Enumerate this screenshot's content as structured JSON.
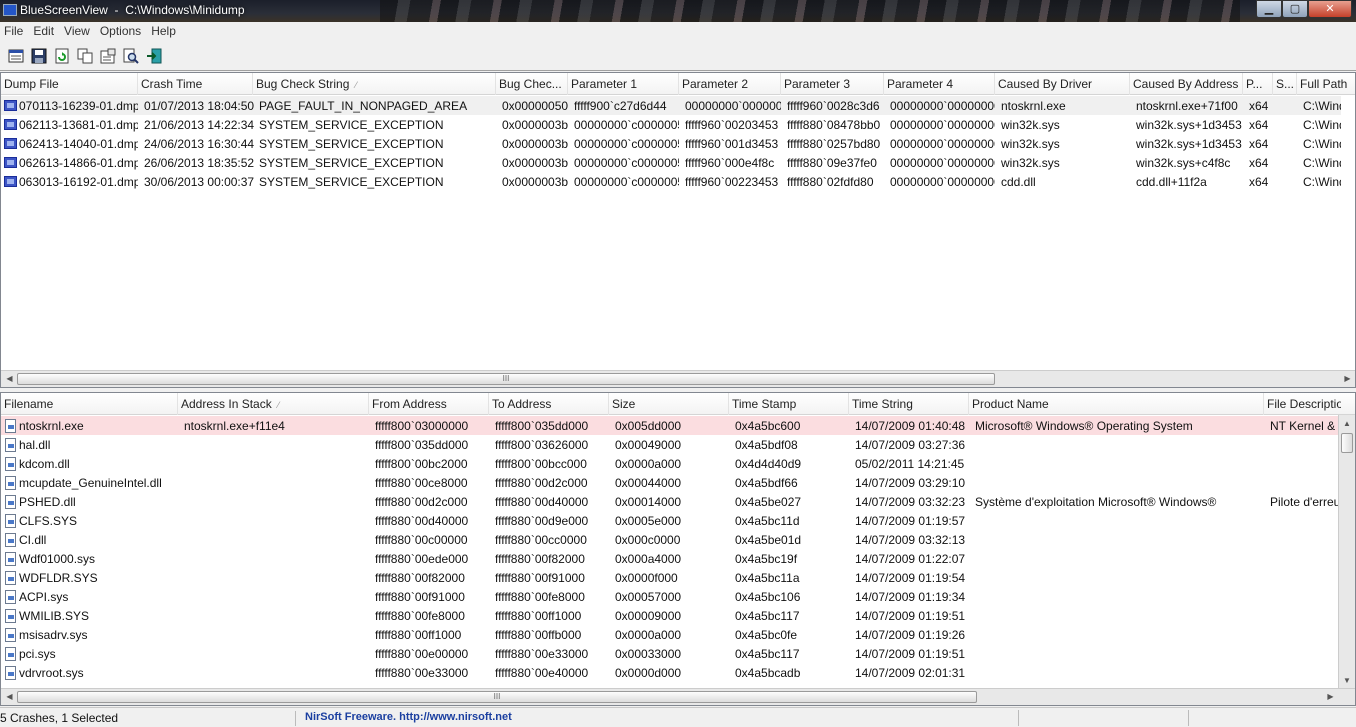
{
  "window": {
    "app_name": "BlueScreenView",
    "path": "C:\\Windows\\Minidump"
  },
  "window_buttons": {
    "minimize": "▁",
    "maximize": "▢",
    "close": "✕"
  },
  "menu": [
    "File",
    "Edit",
    "View",
    "Options",
    "Help"
  ],
  "toolbar": [
    {
      "icon": "html-report-icon"
    },
    {
      "icon": "save-icon"
    },
    {
      "icon": "refresh-icon"
    },
    {
      "icon": "copy-icon"
    },
    {
      "icon": "properties-icon"
    },
    {
      "icon": "find-icon"
    },
    {
      "icon": "exit-icon"
    }
  ],
  "dumps": {
    "columns": [
      "Dump File",
      "Crash Time",
      "Bug Check String",
      "Bug Chec...",
      "Parameter 1",
      "Parameter 2",
      "Parameter 3",
      "Parameter 4",
      "Caused By Driver",
      "Caused By Address",
      "P...",
      "S...",
      "Full Path"
    ],
    "sort_glyph": "⁄",
    "rows": [
      [
        "070113-16239-01.dmp",
        "01/07/2013 18:04:50",
        "PAGE_FAULT_IN_NONPAGED_AREA",
        "0x00000050",
        "fffff900`c27d6d44",
        "00000000`000000...",
        "fffff960`0028c3d6",
        "00000000`00000000",
        "ntoskrnl.exe",
        "ntoskrnl.exe+71f00",
        "x64",
        "",
        "C:\\Windov"
      ],
      [
        "062113-13681-01.dmp",
        "21/06/2013 14:22:34",
        "SYSTEM_SERVICE_EXCEPTION",
        "0x0000003b",
        "00000000`c0000005",
        "fffff960`00203453",
        "fffff880`08478bb0",
        "00000000`00000000",
        "win32k.sys",
        "win32k.sys+1d3453",
        "x64",
        "",
        "C:\\Windov"
      ],
      [
        "062413-14040-01.dmp",
        "24/06/2013 16:30:44",
        "SYSTEM_SERVICE_EXCEPTION",
        "0x0000003b",
        "00000000`c0000005",
        "fffff960`001d3453",
        "fffff880`0257bd80",
        "00000000`00000000",
        "win32k.sys",
        "win32k.sys+1d3453",
        "x64",
        "",
        "C:\\Windov"
      ],
      [
        "062613-14866-01.dmp",
        "26/06/2013 18:35:52",
        "SYSTEM_SERVICE_EXCEPTION",
        "0x0000003b",
        "00000000`c0000005",
        "fffff960`000e4f8c",
        "fffff880`09e37fe0",
        "00000000`00000000",
        "win32k.sys",
        "win32k.sys+c4f8c",
        "x64",
        "",
        "C:\\Windov"
      ],
      [
        "063013-16192-01.dmp",
        "30/06/2013 00:00:37",
        "SYSTEM_SERVICE_EXCEPTION",
        "0x0000003b",
        "00000000`c0000005",
        "fffff960`00223453",
        "fffff880`02fdfd80",
        "00000000`00000000",
        "cdd.dll",
        "cdd.dll+11f2a",
        "x64",
        "",
        "C:\\Windov"
      ]
    ]
  },
  "modules": {
    "columns": [
      "Filename",
      "Address In Stack",
      "From Address",
      "To Address",
      "Size",
      "Time Stamp",
      "Time String",
      "Product Name",
      "File Descriptio"
    ],
    "sort_glyph": "⁄",
    "rows": [
      [
        "ntoskrnl.exe",
        "ntoskrnl.exe+f11e4",
        "fffff800`03000000",
        "fffff800`035dd000",
        "0x005dd000",
        "0x4a5bc600",
        "14/07/2009 01:40:48",
        "Microsoft® Windows® Operating System",
        "NT Kernel &"
      ],
      [
        "hal.dll",
        "",
        "fffff800`035dd000",
        "fffff800`03626000",
        "0x00049000",
        "0x4a5bdf08",
        "14/07/2009 03:27:36",
        "",
        ""
      ],
      [
        "kdcom.dll",
        "",
        "fffff800`00bc2000",
        "fffff800`00bcc000",
        "0x0000a000",
        "0x4d4d40d9",
        "05/02/2011 14:21:45",
        "",
        ""
      ],
      [
        "mcupdate_GenuineIntel.dll",
        "",
        "fffff880`00ce8000",
        "fffff880`00d2c000",
        "0x00044000",
        "0x4a5bdf66",
        "14/07/2009 03:29:10",
        "",
        ""
      ],
      [
        "PSHED.dll",
        "",
        "fffff880`00d2c000",
        "fffff880`00d40000",
        "0x00014000",
        "0x4a5be027",
        "14/07/2009 03:32:23",
        "Système d'exploitation Microsoft® Windows®",
        "Pilote d'erreu"
      ],
      [
        "CLFS.SYS",
        "",
        "fffff880`00d40000",
        "fffff880`00d9e000",
        "0x0005e000",
        "0x4a5bc11d",
        "14/07/2009 01:19:57",
        "",
        ""
      ],
      [
        "CI.dll",
        "",
        "fffff880`00c00000",
        "fffff880`00cc0000",
        "0x000c0000",
        "0x4a5be01d",
        "14/07/2009 03:32:13",
        "",
        ""
      ],
      [
        "Wdf01000.sys",
        "",
        "fffff880`00ede000",
        "fffff880`00f82000",
        "0x000a4000",
        "0x4a5bc19f",
        "14/07/2009 01:22:07",
        "",
        ""
      ],
      [
        "WDFLDR.SYS",
        "",
        "fffff880`00f82000",
        "fffff880`00f91000",
        "0x0000f000",
        "0x4a5bc11a",
        "14/07/2009 01:19:54",
        "",
        ""
      ],
      [
        "ACPI.sys",
        "",
        "fffff880`00f91000",
        "fffff880`00fe8000",
        "0x00057000",
        "0x4a5bc106",
        "14/07/2009 01:19:34",
        "",
        ""
      ],
      [
        "WMILIB.SYS",
        "",
        "fffff880`00fe8000",
        "fffff880`00ff1000",
        "0x00009000",
        "0x4a5bc117",
        "14/07/2009 01:19:51",
        "",
        ""
      ],
      [
        "msisadrv.sys",
        "",
        "fffff880`00ff1000",
        "fffff880`00ffb000",
        "0x0000a000",
        "0x4a5bc0fe",
        "14/07/2009 01:19:26",
        "",
        ""
      ],
      [
        "pci.sys",
        "",
        "fffff880`00e00000",
        "fffff880`00e33000",
        "0x00033000",
        "0x4a5bc117",
        "14/07/2009 01:19:51",
        "",
        ""
      ],
      [
        "vdrvroot.sys",
        "",
        "fffff880`00e33000",
        "fffff880`00e40000",
        "0x0000d000",
        "0x4a5bcadb",
        "14/07/2009 02:01:31",
        "",
        ""
      ]
    ]
  },
  "scroll": {
    "grip": "III",
    "left": "◀",
    "right": "▶",
    "up": "▲",
    "down": "▼"
  },
  "status": {
    "counts": "5 Crashes, 1 Selected",
    "credit": "NirSoft Freeware.  http://www.nirsoft.net"
  },
  "colors": {
    "selected_row": "#f0f0f0",
    "highlight_row": "#fbdde0",
    "link": "#1b3fa0"
  }
}
